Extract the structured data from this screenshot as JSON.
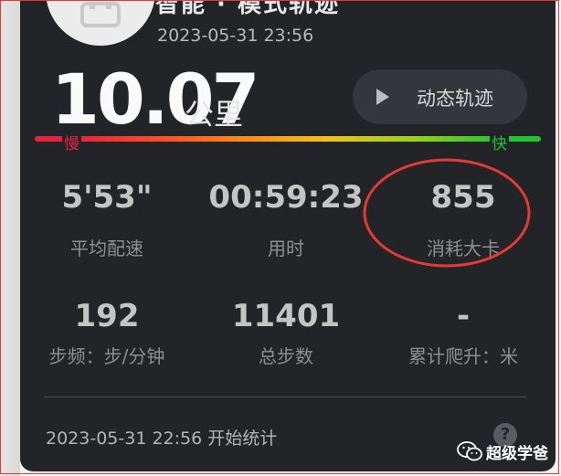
{
  "header": {
    "title_cut": "智能 · 模式轨迹",
    "date": "2023-05-31 23:56"
  },
  "distance": {
    "value": "10.07",
    "unit": "公里"
  },
  "track_button": {
    "label": "动态轨迹",
    "icon": "play-icon"
  },
  "speed_legend": {
    "slow": "慢",
    "fast": "快",
    "colors": [
      "#e8223d",
      "#ff8c1a",
      "#f1c21b",
      "#9ad01e",
      "#22c531"
    ]
  },
  "stats": [
    {
      "value": "5'53\"",
      "label": "平均配速"
    },
    {
      "value": "00:59:23",
      "label": "用时"
    },
    {
      "value": "855",
      "label": "消耗大卡"
    },
    {
      "value": "192",
      "label": "步频：步/分钟"
    },
    {
      "value": "11401",
      "label": "总步数"
    },
    {
      "value": "-",
      "label": "累计爬升：米"
    }
  ],
  "footer": {
    "start_text": "2023-05-31 22:56 开始统计",
    "help_icon": "question-icon"
  },
  "watermark": {
    "text": "超级学爸"
  },
  "annotation": {
    "highlight_color": "#e53935"
  }
}
